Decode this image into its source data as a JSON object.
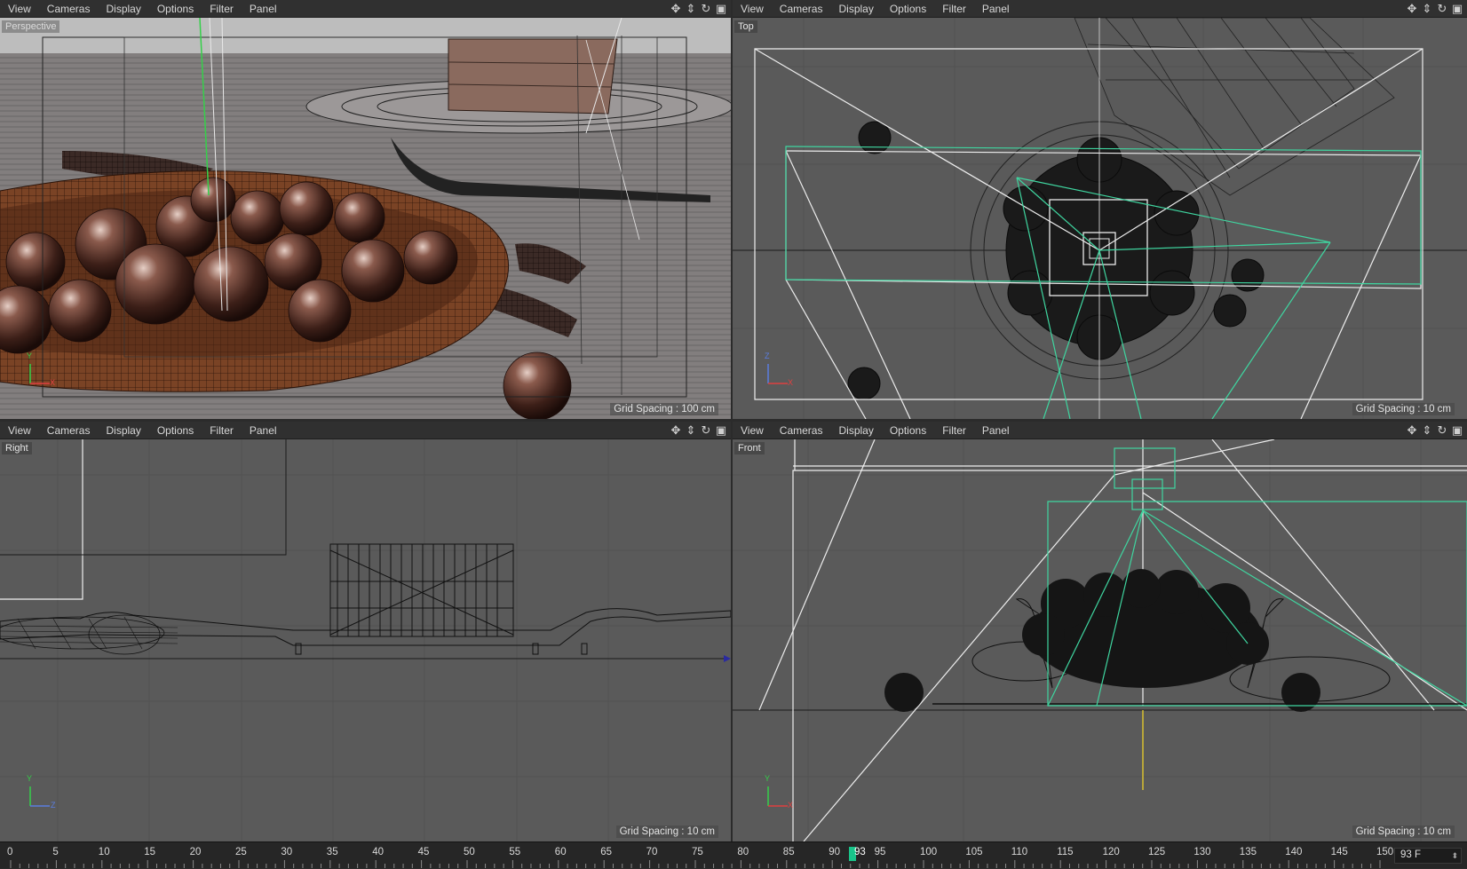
{
  "viewports": [
    {
      "id": "perspective",
      "label": "Perspective",
      "menu": [
        "View",
        "Cameras",
        "Display",
        "Options",
        "Filter",
        "Panel"
      ],
      "grid_spacing": "Grid Spacing : 100 cm"
    },
    {
      "id": "top",
      "label": "Top",
      "menu": [
        "View",
        "Cameras",
        "Display",
        "Options",
        "Filter",
        "Panel"
      ],
      "grid_spacing": "Grid Spacing : 10 cm"
    },
    {
      "id": "right",
      "label": "Right",
      "menu": [
        "View",
        "Cameras",
        "Display",
        "Options",
        "Filter",
        "Panel"
      ],
      "grid_spacing": "Grid Spacing : 10 cm"
    },
    {
      "id": "front",
      "label": "Front",
      "menu": [
        "View",
        "Cameras",
        "Display",
        "Options",
        "Filter",
        "Panel"
      ],
      "grid_spacing": "Grid Spacing : 10 cm"
    }
  ],
  "viewport_controls": [
    "move-icon",
    "zoom-icon",
    "rotate-icon",
    "maximize-icon"
  ],
  "axis_labels": {
    "y": "Y",
    "x": "X",
    "z": "Z"
  },
  "timeline": {
    "ticks": [
      "0",
      "5",
      "10",
      "15",
      "20",
      "25",
      "30",
      "35",
      "40",
      "45",
      "50",
      "55",
      "60",
      "65",
      "70",
      "75",
      "80",
      "85",
      "90",
      "93",
      "95",
      "100",
      "105",
      "110",
      "115",
      "120",
      "125",
      "130",
      "135",
      "140",
      "145",
      "150"
    ],
    "tick_values": [
      0,
      5,
      10,
      15,
      20,
      25,
      30,
      35,
      40,
      45,
      50,
      55,
      60,
      65,
      70,
      75,
      80,
      85,
      90,
      null,
      95,
      100,
      105,
      110,
      115,
      120,
      125,
      130,
      135,
      140,
      145,
      150
    ],
    "current_frame": 93,
    "current_label": "93",
    "frame_field": "93 F"
  },
  "colors": {
    "viewport_bg": "#5a5a5a",
    "menu_bg": "#303030",
    "wire_dark": "#111111",
    "camera_green": "#3fd6a0",
    "white_line": "#f0f0f0",
    "playhead": "#19c48a"
  }
}
